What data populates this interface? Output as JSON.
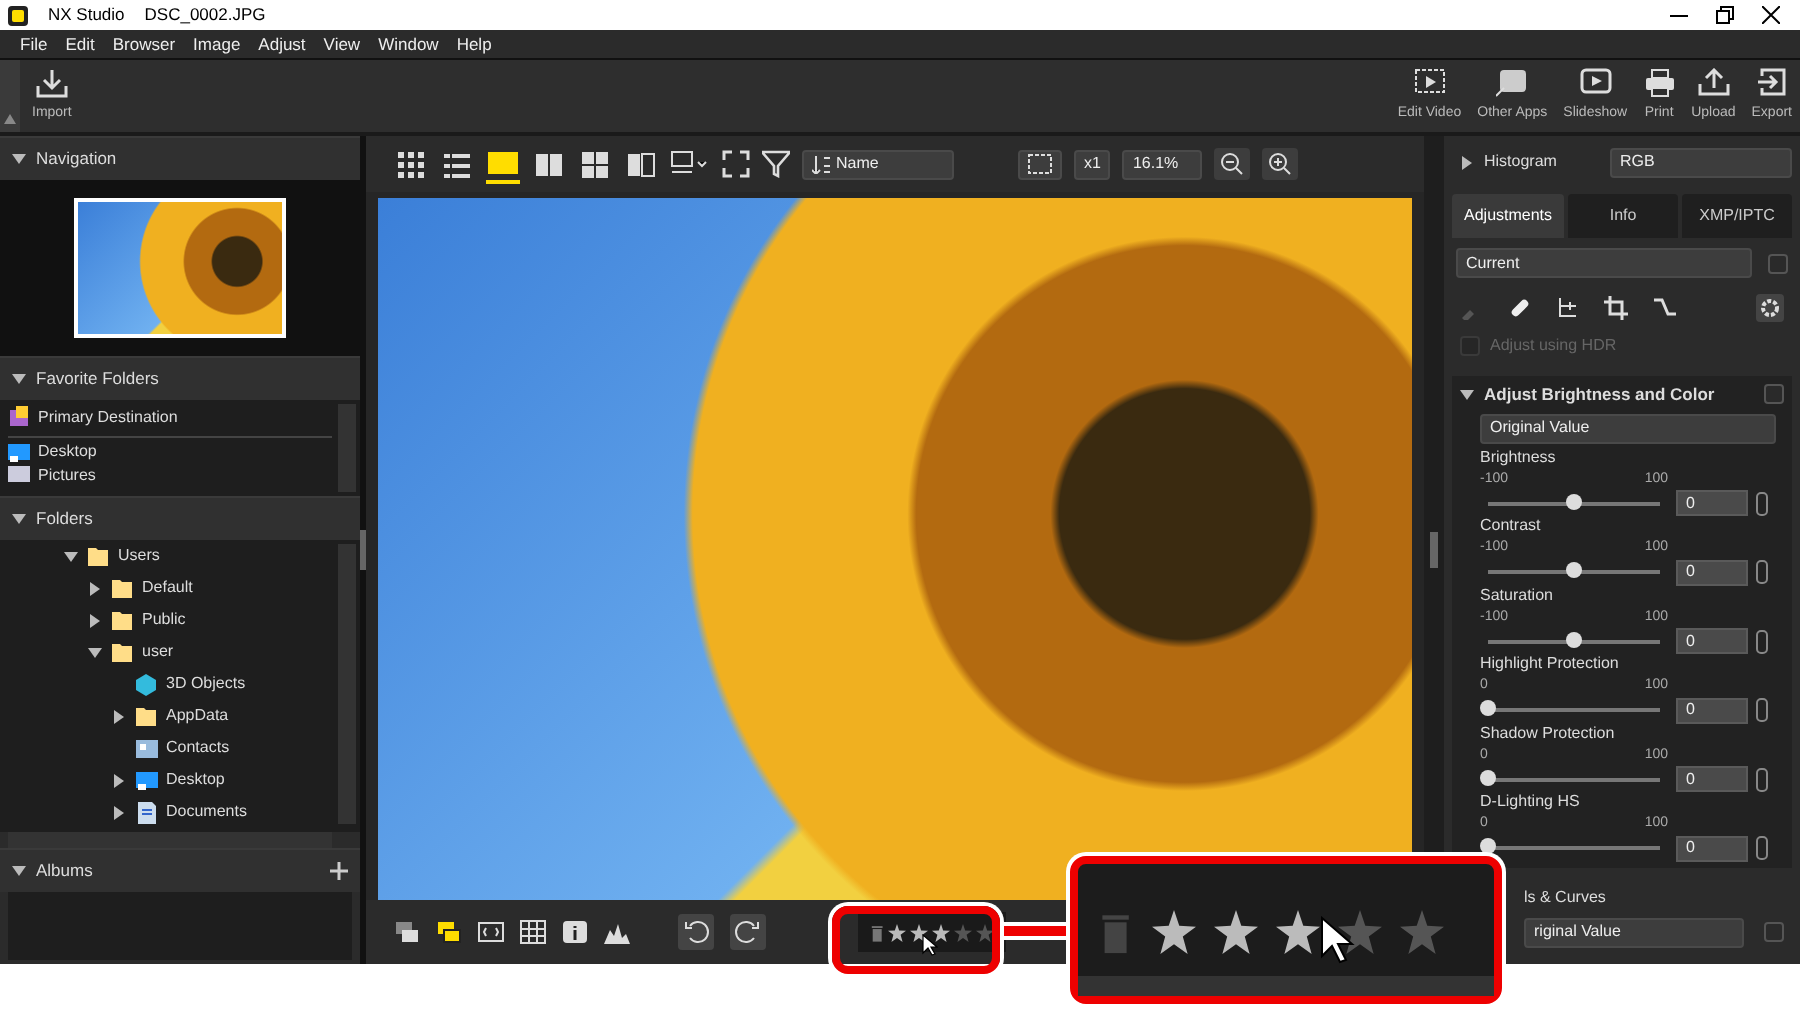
{
  "window": {
    "app": "NX Studio",
    "title": "DSC_0002.JPG"
  },
  "menu": [
    "File",
    "Edit",
    "Browser",
    "Image",
    "Adjust",
    "View",
    "Window",
    "Help"
  ],
  "toolbar_left": [
    "Import"
  ],
  "toolbar_right": [
    "Edit Video",
    "Other Apps",
    "Slideshow",
    "Print",
    "Upload",
    "Export"
  ],
  "navigation": {
    "title": "Navigation"
  },
  "favorite_folders": {
    "title": "Favorite Folders",
    "items": [
      {
        "label": "Primary Destination",
        "kind": "primary"
      },
      {
        "label": "Desktop",
        "kind": "desktop"
      },
      {
        "label": "Pictures",
        "kind": "pictures"
      }
    ]
  },
  "folders": {
    "title": "Folders",
    "tree": [
      {
        "label": "Users",
        "kind": "folder",
        "expandable": true,
        "expanded": true,
        "children": [
          {
            "label": "Default",
            "kind": "folder",
            "expandable": true,
            "expanded": false
          },
          {
            "label": "Public",
            "kind": "folder",
            "expandable": true,
            "expanded": false
          },
          {
            "label": "user",
            "kind": "folder",
            "expandable": true,
            "expanded": true,
            "children": [
              {
                "label": "3D Objects",
                "kind": "objects",
                "expandable": false
              },
              {
                "label": "AppData",
                "kind": "folder",
                "expandable": true,
                "expanded": false
              },
              {
                "label": "Contacts",
                "kind": "contacts",
                "expandable": false
              },
              {
                "label": "Desktop",
                "kind": "desktop",
                "expandable": true,
                "expanded": false
              },
              {
                "label": "Documents",
                "kind": "documents",
                "expandable": true,
                "expanded": false
              }
            ]
          }
        ]
      }
    ]
  },
  "albums": {
    "title": "Albums"
  },
  "view_modes": [
    {
      "selected": false
    },
    {
      "selected": false
    },
    {
      "selected": true
    },
    {
      "selected": false
    },
    {
      "selected": false
    },
    {
      "selected": false
    }
  ],
  "sort": "Name",
  "zoom_button": "x1",
  "zoom": "16.1%",
  "histogram": {
    "title": "Histogram",
    "channel": "RGB"
  },
  "tabs": [
    {
      "label": "Adjustments",
      "selected": true
    },
    {
      "label": "Info",
      "selected": false
    },
    {
      "label": "XMP/IPTC",
      "selected": false
    }
  ],
  "preset": "Current",
  "sync_checked": false,
  "hdr": {
    "label": "Adjust using HDR",
    "checked": false,
    "disabled": true
  },
  "adjust_section": {
    "title": "Adjust Brightness and Color",
    "checked": false,
    "preset": "Original Value",
    "sliders": [
      {
        "label": "Brightness",
        "min": "-100",
        "max": "100",
        "level": 0.5,
        "value": "0"
      },
      {
        "label": "Contrast",
        "min": "-100",
        "max": "100",
        "level": 0.5,
        "value": "0"
      },
      {
        "label": "Saturation",
        "min": "-100",
        "max": "100",
        "level": 0.5,
        "value": "0"
      },
      {
        "label": "Highlight Protection",
        "min": "0",
        "max": "100",
        "level": 0,
        "value": "0"
      },
      {
        "label": "Shadow Protection",
        "min": "0",
        "max": "100",
        "level": 0,
        "value": "0"
      },
      {
        "label": "D-Lighting HS",
        "min": "0",
        "max": "100",
        "level": 0,
        "value": "0"
      }
    ]
  },
  "levels_section": {
    "title": "ls & Curves",
    "checked": false,
    "preset": "riginal Value"
  },
  "rating": {
    "stars": 3
  },
  "rating_callout": {
    "stars": 3
  }
}
